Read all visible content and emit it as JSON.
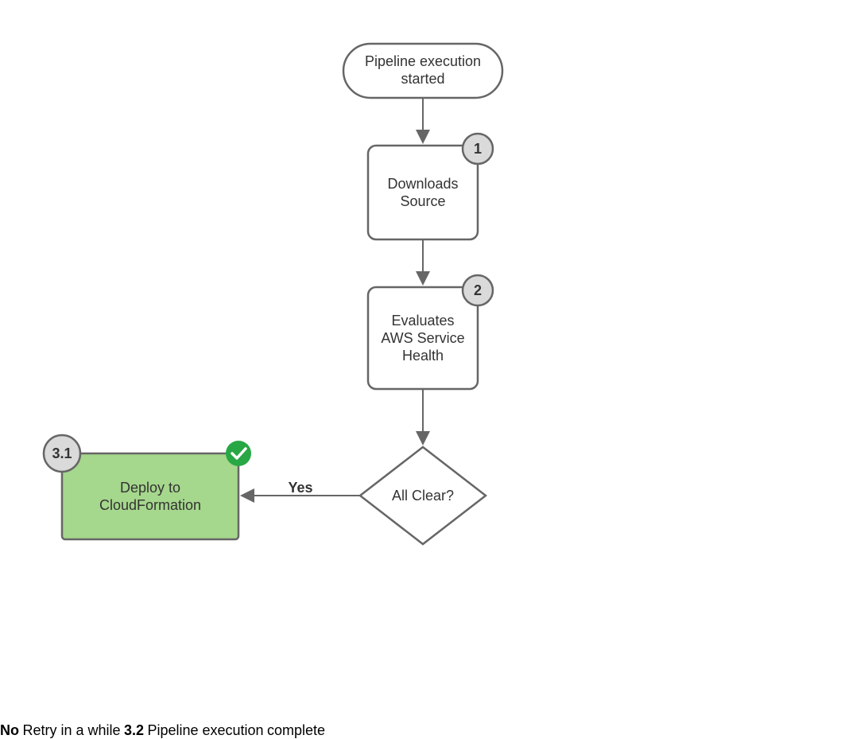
{
  "diagram": {
    "nodes": {
      "start": {
        "line1": "Pipeline execution",
        "line2": "started"
      },
      "step1": {
        "badge": "1",
        "line1": "Downloads",
        "line2": "Source"
      },
      "step2": {
        "badge": "2",
        "line1": "Evaluates",
        "line2": "AWS Service",
        "line3": "Health"
      },
      "decision": {
        "label": "All Clear?"
      },
      "deploy": {
        "badge": "3.1",
        "line1": "Deploy to",
        "line2": "CloudFormation"
      },
      "retry": {
        "badge": "3.2",
        "label": "Retry in a while"
      },
      "end": {
        "line1": "Pipeline execution",
        "line2": "complete"
      }
    },
    "edges": {
      "yes": "Yes",
      "no": "No"
    },
    "colors": {
      "stroke": "#666666",
      "badge_fill": "#DADADA",
      "success_fill": "#A5D78C",
      "error_fill": "#F5C4CF",
      "success_icon": "#28A745",
      "error_icon": "#D0021B"
    }
  }
}
